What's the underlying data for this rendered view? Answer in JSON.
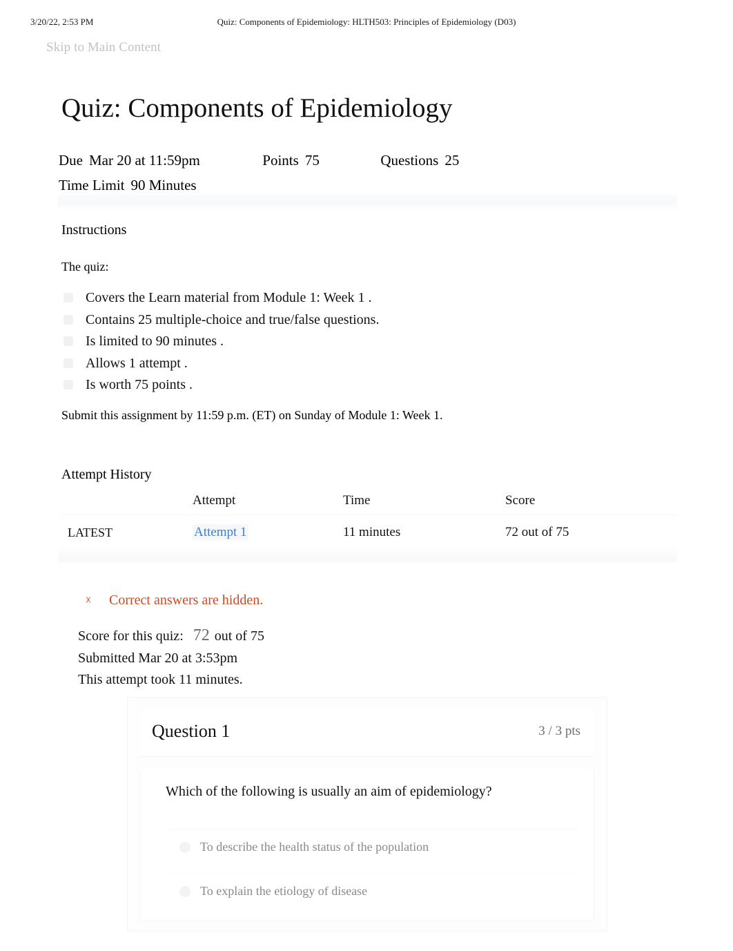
{
  "print_header": {
    "date": "3/20/22, 2:53 PM",
    "title": "Quiz: Components of Epidemiology: HLTH503: Principles of Epidemiology (D03)"
  },
  "skip_link": "Skip to Main Content",
  "page_title": "Quiz: Components of Epidemiology",
  "meta": {
    "due_label": "Due",
    "due_value": "Mar 20 at 11:59pm",
    "points_label": "Points",
    "points_value": "75",
    "questions_label": "Questions",
    "questions_value": "25",
    "time_limit_label": "Time Limit",
    "time_limit_value": "90 Minutes"
  },
  "instructions": {
    "heading": "Instructions",
    "intro": "The quiz:",
    "bullets": [
      "Covers the   Learn  material from    Module 1: Week 1   .",
      "Contains   25 multiple-choice     and  true/false    questions.",
      "Is limited  to  90  minutes  .",
      "Allows  1 attempt   .",
      "Is worth 75 points    ."
    ],
    "submit_note": "Submit this assignment by 11:59 p.m. (ET) on Sunday of Module 1: Week 1."
  },
  "attempt_history": {
    "heading": "Attempt History",
    "columns": [
      "",
      "Attempt",
      "Time",
      "Score"
    ],
    "rows": [
      {
        "flag": "LATEST",
        "attempt": "Attempt 1",
        "time": "11 minutes",
        "score": "72 out of 75"
      }
    ]
  },
  "notice": {
    "icon": "warning-icon",
    "glyph": "☓",
    "text": "Correct answers are hidden.",
    "color": "#cc4a1f"
  },
  "score_summary": {
    "score_label": "Score for this quiz:",
    "score_value": "72",
    "score_suffix": "out of 75",
    "submitted": "Submitted Mar 20 at 3:53pm",
    "duration": "This attempt took 11 minutes."
  },
  "question": {
    "title": "Question 1",
    "points": "3 / 3 pts",
    "text": "Which of the following is usually an aim of epidemiology?",
    "answers": [
      "To  describe   the health status of the population",
      "To  explain  the etiology of disease"
    ]
  },
  "colors": {
    "link": "#3d7fd1",
    "accent_warning": "#cc4a1f",
    "muted": "#8a8a8c"
  }
}
